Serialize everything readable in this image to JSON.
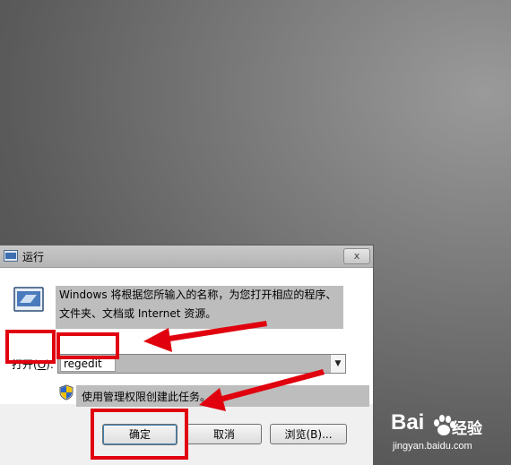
{
  "dialog": {
    "title": "运行",
    "close_label": "x",
    "description_line1": "Windows 将根据您所输入的名称，为您打开相应的程序、",
    "description_line2": "文件夹、文档或 Internet 资源。",
    "open_label_prefix": "打开(",
    "open_label_accel": "O",
    "open_label_suffix": "):",
    "command_value": "regedit",
    "admin_note": "使用管理权限创建此任务。",
    "buttons": {
      "ok": "确定",
      "cancel": "取消",
      "browse": "浏览(B)..."
    }
  },
  "annotations": {
    "highlight_color": "#e0000e"
  },
  "watermark": {
    "brand": "Bai",
    "brand_cn": "经验",
    "url": "jingyan.baidu.com"
  },
  "icons": [
    "run-icon",
    "close-icon",
    "shield-icon",
    "dropdown-arrow-icon",
    "paw-icon"
  ]
}
